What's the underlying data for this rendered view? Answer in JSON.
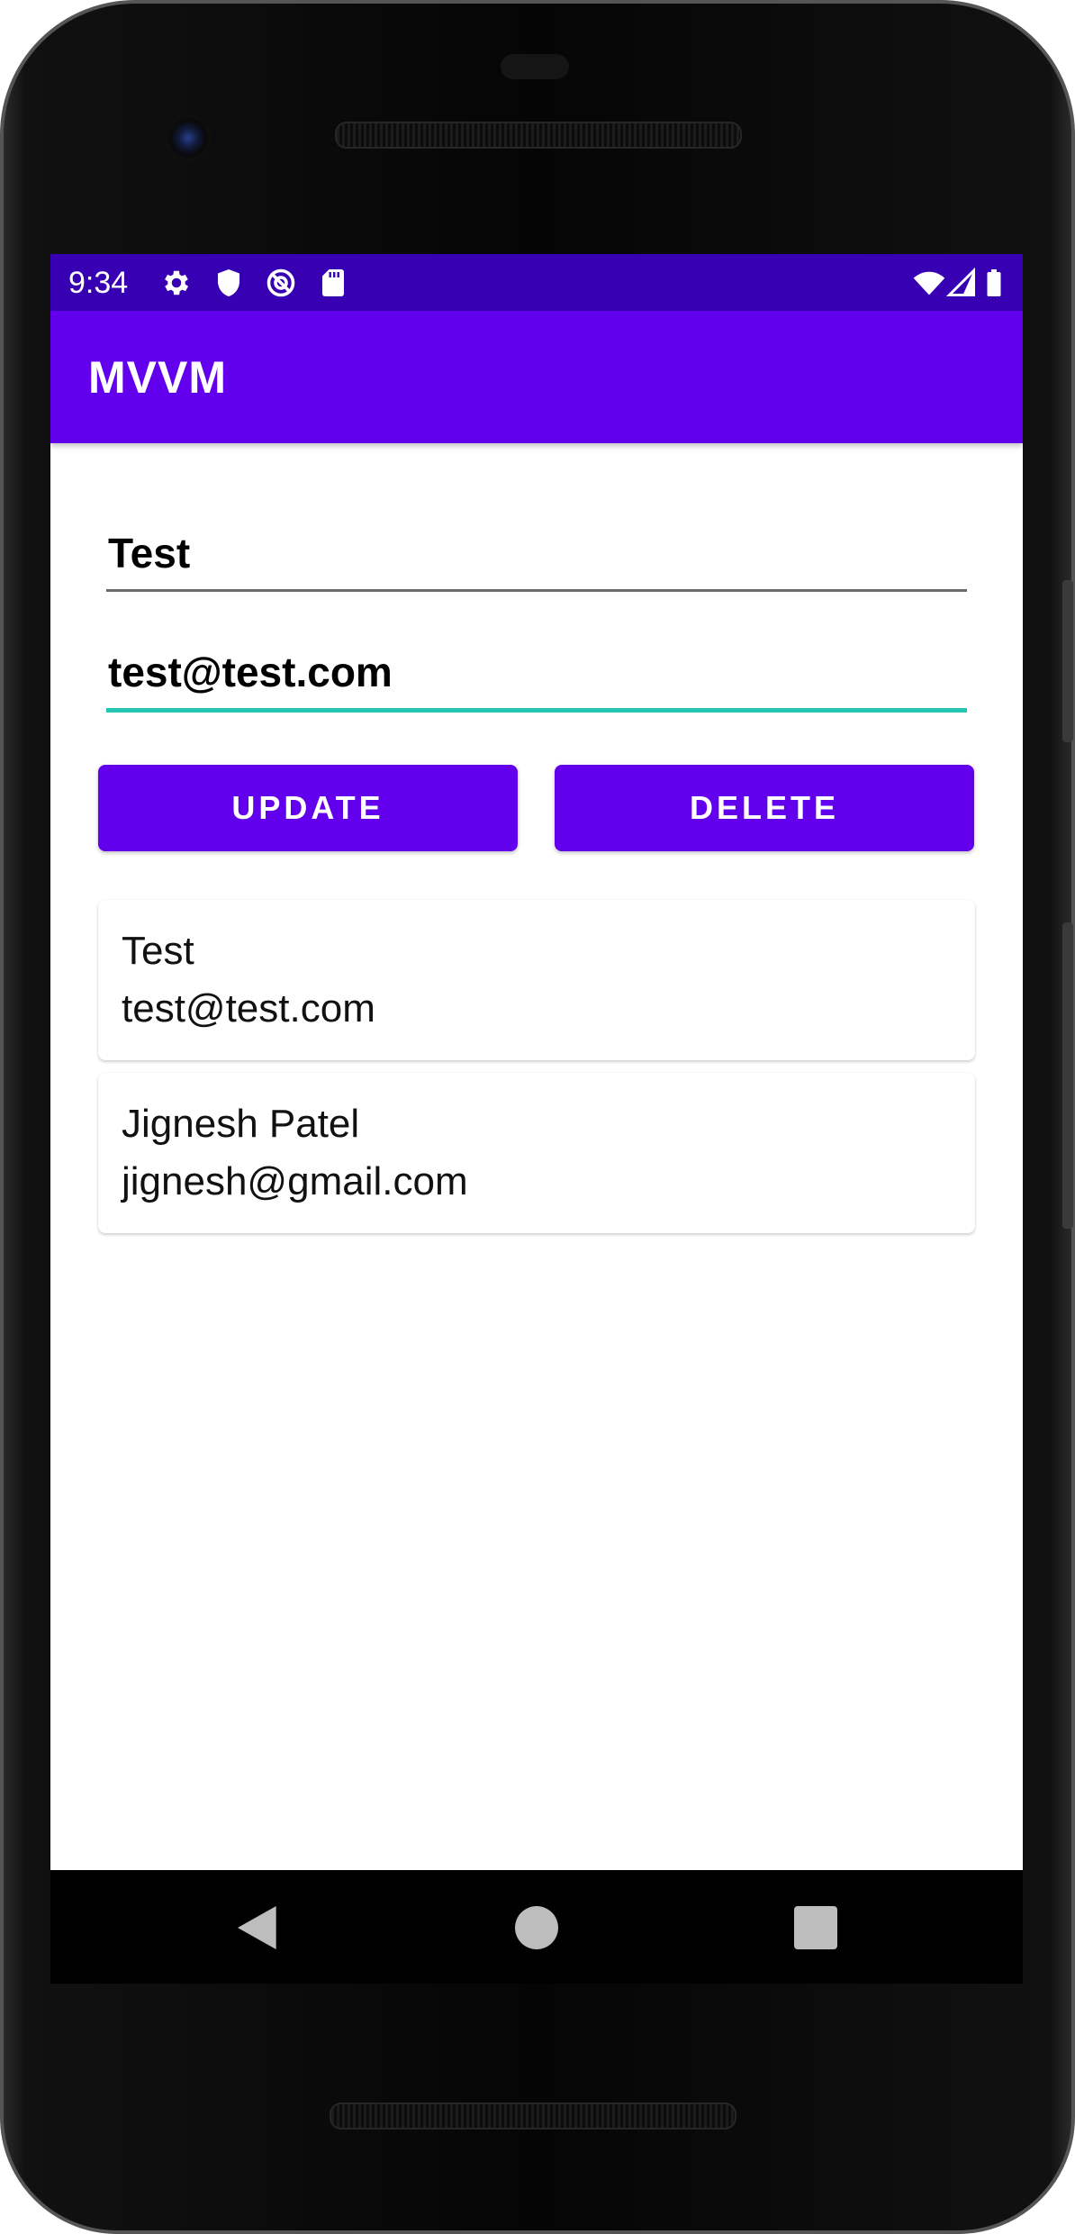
{
  "status_bar": {
    "time": "9:34",
    "left_icons": [
      "gear-icon",
      "shield-icon",
      "sync-circle-icon",
      "sd-card-icon"
    ],
    "right_icons": [
      "wifi-icon",
      "signal-icon",
      "battery-icon"
    ]
  },
  "app_bar": {
    "title": "MVVM"
  },
  "form": {
    "name_value": "Test",
    "email_value": "test@test.com"
  },
  "buttons": {
    "update_label": "UPDATE",
    "delete_label": "DELETE"
  },
  "users": [
    {
      "name": "Test",
      "email": "test@test.com"
    },
    {
      "name": "Jignesh Patel",
      "email": "jignesh@gmail.com"
    }
  ],
  "nav": {
    "icons": [
      "back-icon",
      "home-icon",
      "recents-icon"
    ]
  },
  "colors": {
    "primary": "#6200ee",
    "primary_dark": "#3700b3",
    "accent": "#26c6b4"
  }
}
